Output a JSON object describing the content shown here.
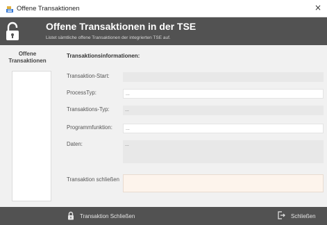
{
  "window": {
    "title": "Offene Transaktionen",
    "close_glyph": "×",
    "app_icon": "register-icon"
  },
  "header": {
    "title": "Offene Transaktionen in der TSE",
    "subtitle": "Listet sämtliche offene Transaktionen der integrierten TSE auf.",
    "icon": "unlock-icon"
  },
  "left_panel": {
    "title": "Offene Transaktionen",
    "items": []
  },
  "details": {
    "section_title": "Transaktionsinformationen:",
    "fields": [
      {
        "label": "Transaktion-Start:",
        "value": ""
      },
      {
        "label": "ProcessTyp:",
        "value": "..."
      },
      {
        "label": "Transaktions-Typ:",
        "value": "..."
      },
      {
        "label": "Programmfunktion:",
        "value": "..."
      },
      {
        "label": "Daten:",
        "value": "..."
      }
    ],
    "close_label": "Transaktion schließen",
    "close_value": ""
  },
  "footer": {
    "close_transaction_label": "Transaktion Schließen",
    "close_label": "Schließen"
  }
}
